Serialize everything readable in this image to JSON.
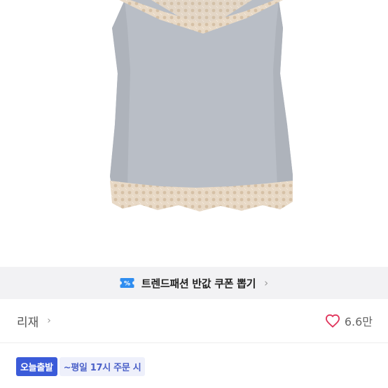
{
  "coupon_banner": {
    "text": "트렌드패션 반값 쿠폰 뽑기",
    "icon": "coupon-ticket-icon",
    "icon_color": "#2f8df0",
    "chevron": "›"
  },
  "seller": {
    "name": "리재",
    "chevron": "›"
  },
  "likes": {
    "count": "6.6만",
    "icon": "heart-icon",
    "color": "#e0345b"
  },
  "badges": {
    "today": "오늘출발",
    "time": "~평일 17시 주문 시"
  },
  "colors": {
    "banner_bg": "#f2f2f4",
    "badge_blue": "#3b5bd9"
  }
}
